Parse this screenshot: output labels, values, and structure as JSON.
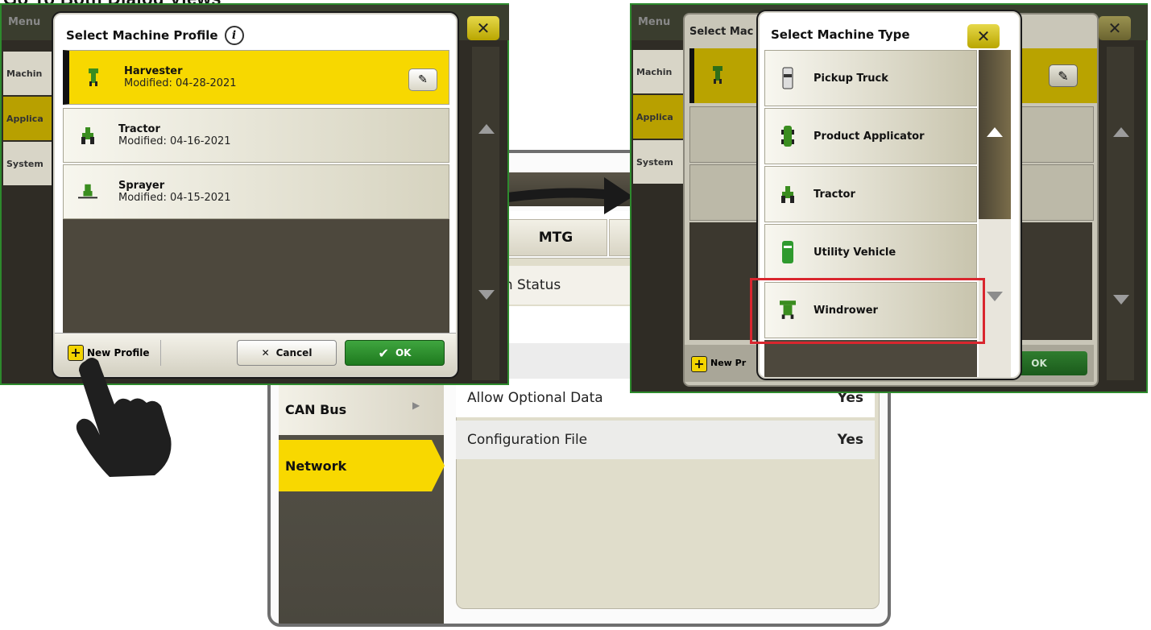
{
  "top_heading": "Go To Both Dialog Views",
  "device": {
    "tab_label": "MTG",
    "status_label": "tration Status",
    "side_items": [
      "CAN Bus",
      "Network"
    ],
    "rows": [
      {
        "label": "Allow Optional Data",
        "value": "Yes"
      },
      {
        "label": "Configuration File",
        "value": "Yes"
      }
    ]
  },
  "left_panel": {
    "menu_label": "Menu",
    "side_items": [
      "Machin",
      "Applica",
      "System"
    ],
    "close_label": "✕"
  },
  "profile_dialog": {
    "title": "Select Machine Profile",
    "info_icon": "i",
    "profiles": [
      {
        "name": "Harvester",
        "modified": "Modified: 04-28-2021",
        "icon": "harvester-icon",
        "selected": true
      },
      {
        "name": "Tractor",
        "modified": "Modified: 04-16-2021",
        "icon": "tractor-icon",
        "selected": false
      },
      {
        "name": "Sprayer",
        "modified": "Modified: 04-15-2021",
        "icon": "sprayer-icon",
        "selected": false
      }
    ],
    "new_profile_label": "New Profile",
    "cancel_label": "Cancel",
    "ok_label": "OK"
  },
  "right_panel": {
    "menu_label": "Menu",
    "side_items": [
      "Machin",
      "Applica",
      "System"
    ],
    "bg_dialog_title": "Select Mac",
    "new_profile_partial": "New Pr",
    "ok_label": "OK"
  },
  "type_dialog": {
    "title": "Select Machine Type",
    "close_label": "✕",
    "types": [
      {
        "label": "Pickup Truck",
        "icon": "pickup-truck-icon"
      },
      {
        "label": "Product Applicator",
        "icon": "product-applicator-icon"
      },
      {
        "label": "Tractor",
        "icon": "tractor-icon"
      },
      {
        "label": "Utility Vehicle",
        "icon": "utility-vehicle-icon"
      },
      {
        "label": "Windrower",
        "icon": "windrower-icon",
        "highlighted": true
      }
    ]
  },
  "colors": {
    "jd_green": "#2d8a2d",
    "jd_yellow": "#f7d800",
    "highlight_red": "#d9262e"
  }
}
